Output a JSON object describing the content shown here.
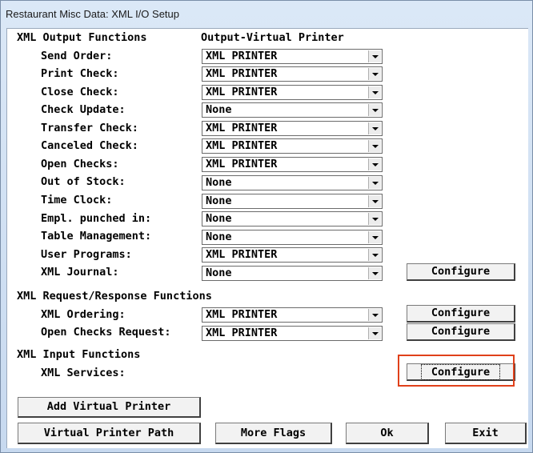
{
  "window": {
    "title": "Restaurant Misc Data: XML I/O Setup"
  },
  "sections": {
    "output_header": "XML Output Functions",
    "output_column_header": "Output-Virtual Printer",
    "request_header": "XML Request/Response Functions",
    "input_header": "XML Input Functions"
  },
  "output_rows": [
    {
      "label": "Send Order:",
      "value": "XML PRINTER"
    },
    {
      "label": "Print Check:",
      "value": "XML PRINTER"
    },
    {
      "label": "Close Check:",
      "value": "XML PRINTER"
    },
    {
      "label": "Check Update:",
      "value": "None"
    },
    {
      "label": "Transfer Check:",
      "value": "XML PRINTER"
    },
    {
      "label": "Canceled Check:",
      "value": "XML PRINTER"
    },
    {
      "label": "Open Checks:",
      "value": "XML PRINTER"
    },
    {
      "label": "Out of Stock:",
      "value": "None"
    },
    {
      "label": "Time Clock:",
      "value": "None"
    },
    {
      "label": "Empl. punched in:",
      "value": "None"
    },
    {
      "label": "Table Management:",
      "value": "None"
    },
    {
      "label": "User Programs:",
      "value": "XML PRINTER"
    },
    {
      "label": "XML Journal:",
      "value": "None"
    }
  ],
  "request_rows": [
    {
      "label": "XML Ordering:",
      "value": "XML PRINTER"
    },
    {
      "label": "Open Checks Request:",
      "value": "XML PRINTER"
    }
  ],
  "input_rows": [
    {
      "label": "XML Services:"
    }
  ],
  "buttons": {
    "configure": "Configure",
    "add_virtual_printer": "Add Virtual Printer",
    "virtual_printer_path": "Virtual Printer Path",
    "more_flags": "More Flags",
    "ok": "Ok",
    "exit": "Exit"
  },
  "colors": {
    "highlight": "#e0401a"
  }
}
